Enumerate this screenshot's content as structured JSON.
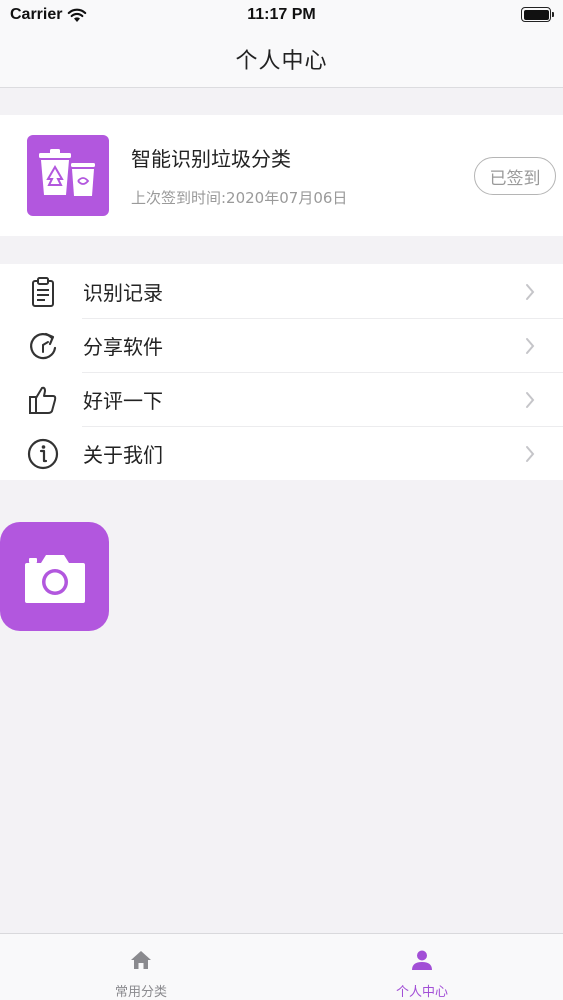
{
  "status_bar": {
    "carrier": "Carrier",
    "time": "11:17 PM"
  },
  "nav": {
    "title": "个人中心"
  },
  "profile": {
    "app_name": "智能识别垃圾分类",
    "checkin_time": "上次签到时间:2020年07月06日",
    "checkin_button": "已签到",
    "logo_icon": "trash-can-icon"
  },
  "menu": {
    "items": [
      {
        "label": "识别记录",
        "icon": "clipboard-icon"
      },
      {
        "label": "分享软件",
        "icon": "share-icon"
      },
      {
        "label": "好评一下",
        "icon": "thumbs-up-icon"
      },
      {
        "label": "关于我们",
        "icon": "info-icon"
      }
    ]
  },
  "camera": {
    "icon": "camera-icon"
  },
  "tab_bar": {
    "tabs": [
      {
        "label": "常用分类",
        "icon": "home-icon",
        "active": false
      },
      {
        "label": "个人中心",
        "icon": "person-icon",
        "active": true
      }
    ]
  },
  "colors": {
    "accent": "#b257de",
    "active_tab": "#a24fd6",
    "background": "#f3f2f5"
  }
}
